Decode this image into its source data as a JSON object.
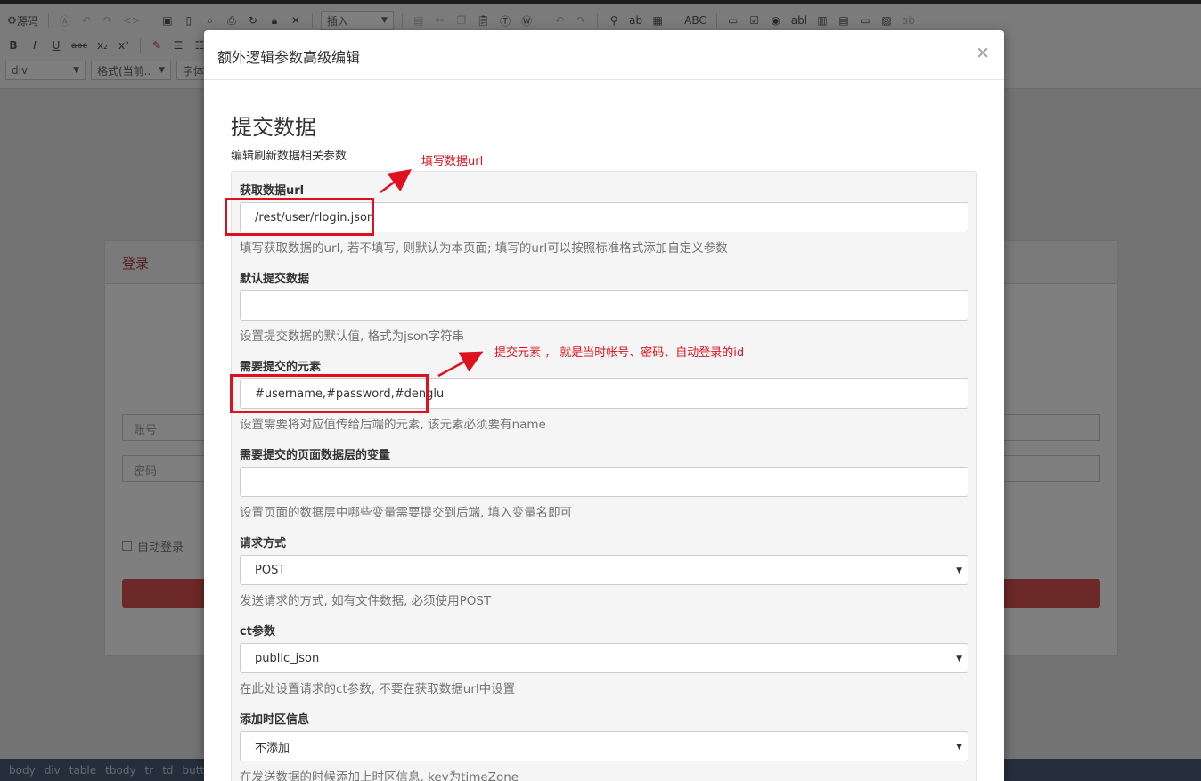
{
  "editor": {
    "source_label": "源码",
    "insert_combo": "插入",
    "bold": "B",
    "italic": "I",
    "underline": "U",
    "strike": "abc",
    "subscript": "x₂",
    "superscript": "x²",
    "tag_combo": "div",
    "format_combo": "格式(当前..",
    "font_combo": "字体",
    "spell_label": "ABC",
    "ab_label": "abl"
  },
  "page_behind": {
    "login_title": "登录",
    "account_placeholder": "账号",
    "password_placeholder": "密码",
    "auto_login_label": "自动登录"
  },
  "status_path": [
    "body",
    "div",
    "table",
    "tbody",
    "tr",
    "td",
    "button"
  ],
  "modal": {
    "title": "额外逻辑参数高级编辑",
    "close_label": "×",
    "section_title": "提交数据",
    "section_desc": "编辑刷新数据相关参数",
    "fields": [
      {
        "label": "获取数据url",
        "value": "/rest/user/rlogin.json",
        "help": "填写获取数据的url, 若不填写, 则默认为本页面; 填写的url可以按照标准格式添加自定义参数"
      },
      {
        "label": "默认提交数据",
        "value": "",
        "help": "设置提交数据的默认值, 格式为json字符串"
      },
      {
        "label": "需要提交的元素",
        "value": "#username,#password,#denglu",
        "help": "设置需要将对应值传给后端的元素, 该元素必须要有name"
      },
      {
        "label": "需要提交的页面数据层的变量",
        "value": "",
        "help": "设置页面的数据层中哪些变量需要提交到后端, 填入变量名即可"
      },
      {
        "label": "请求方式",
        "value": "POST",
        "help": "发送请求的方式, 如有文件数据, 必须使用POST"
      },
      {
        "label": "ct参数",
        "value": "public_json",
        "help": "在此处设置请求的ct参数, 不要在获取数据url中设置"
      },
      {
        "label": "添加时区信息",
        "value": "不添加",
        "help": "在发送数据的时候添加上时区信息, key为timeZone"
      }
    ]
  },
  "annotations": {
    "url_note": "填写数据url",
    "elements_note": "提交元素 ， 就是当时帐号、密码、自动登录的id",
    "color": "#e0111f"
  }
}
